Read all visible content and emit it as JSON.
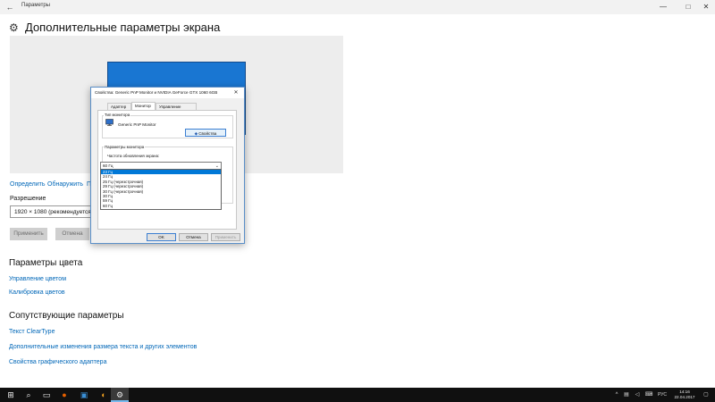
{
  "window": {
    "title": "Параметры",
    "back_icon": "←",
    "minimize_icon": "—",
    "maximize_icon": "□",
    "close_icon": "✕"
  },
  "page": {
    "gear_icon": "⚙",
    "title": "Дополнительные параметры экрана"
  },
  "display_links": {
    "identify": "Определить",
    "detect": "Обнаружить",
    "partial": "П"
  },
  "resolution": {
    "label": "Разрешение",
    "value": "1920 × 1080 (рекомендуется)"
  },
  "buttons": {
    "apply": "Применить",
    "cancel": "Отмена"
  },
  "color_settings": {
    "heading": "Параметры цвета",
    "manage_color": "Управление цветом",
    "calibrate": "Калибровка цветов"
  },
  "related": {
    "heading": "Сопутствующие параметры",
    "cleartype": "Текст ClearType",
    "text_size": "Дополнительные изменения размера текста и других элементов",
    "adapter_props": "Свойства графического адаптера"
  },
  "dialog": {
    "title": "Свойства: Generic PnP Monitor и NVIDIA GeForce GTX 1060 6GB",
    "close_icon": "✕",
    "tabs": [
      "Адаптер",
      "Монитор",
      "Управление цветом"
    ],
    "monitor_type_legend": "Тип монитора",
    "monitor_name": "Generic PnP Monitor",
    "properties_button": "Свойства",
    "shield_icon": "◆",
    "monitor_params_legend": "Параметры монитора",
    "refresh_label": "Частота обновления экрана:",
    "refresh_selected": "60 Гц",
    "chevron_icon": "⌄",
    "refresh_options": [
      "23 Гц",
      "24 Гц",
      "25 Гц (черезстрочная)",
      "29 Гц (черезстрочная)",
      "30 Гц (черезстрочная)",
      "30 Гц",
      "59 Гц",
      "60 Гц"
    ],
    "ok_button": "OK",
    "cancel_button": "Отмена",
    "apply_button": "Применить"
  },
  "taskbar": {
    "start_icon": "⊞",
    "search_icon": "⌕",
    "taskview_icon": "▭",
    "firefox_icon": "●",
    "terminal_icon": "▣",
    "game_icon": "◐",
    "settings_icon": "⚙",
    "tray_up_icon": "^",
    "network_icon": "▤",
    "volume_icon": "◁",
    "keyboard_icon": "⌨",
    "language": "РУС",
    "time": "14:16",
    "date": "22.04.2017",
    "notification_icon": "▢"
  }
}
